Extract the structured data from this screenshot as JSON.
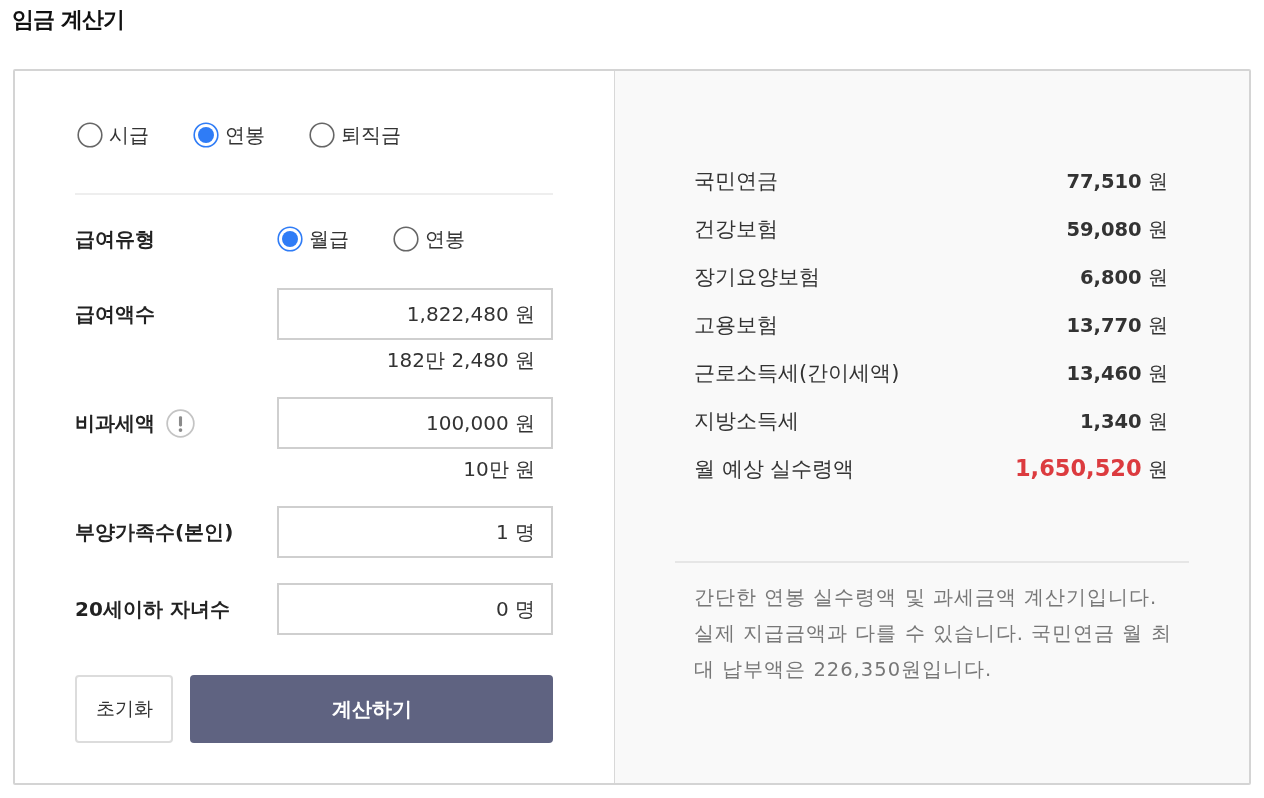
{
  "title": "임금 계산기",
  "calc_type": [
    {
      "label": "시급",
      "selected": false
    },
    {
      "label": "연봉",
      "selected": true
    },
    {
      "label": "퇴직금",
      "selected": false
    }
  ],
  "form": {
    "pay_type": {
      "label": "급여유형",
      "options": [
        {
          "label": "월급",
          "selected": true
        },
        {
          "label": "연봉",
          "selected": false
        }
      ]
    },
    "fields": [
      {
        "label": "급여액수",
        "info": false,
        "value": "1,822,480",
        "unit": "원",
        "hint": "182만 2,480 원"
      },
      {
        "label": "비과세액",
        "info": true,
        "value": "100,000",
        "unit": "원",
        "hint": "10만 원"
      },
      {
        "label": "부양가족수(본인)",
        "info": false,
        "value": "1",
        "unit": "명"
      },
      {
        "label": "20세이하 자녀수",
        "info": false,
        "value": "0",
        "unit": "명"
      }
    ]
  },
  "buttons": [
    {
      "label": "초기화",
      "kind": "secondary"
    },
    {
      "label": "계산하기",
      "kind": "primary"
    }
  ],
  "results": [
    {
      "label": "국민연금",
      "value": "77,510",
      "unit": "원",
      "kind": "deduction"
    },
    {
      "label": "건강보험",
      "value": "59,080",
      "unit": "원",
      "kind": "deduction"
    },
    {
      "label": "장기요양보험",
      "value": "6,800",
      "unit": "원",
      "kind": "deduction"
    },
    {
      "label": "고용보험",
      "value": "13,770",
      "unit": "원",
      "kind": "deduction"
    },
    {
      "label": "근로소득세(간이세액)",
      "value": "13,460",
      "unit": "원",
      "kind": "deduction"
    },
    {
      "label": "지방소득세",
      "value": "1,340",
      "unit": "원",
      "kind": "deduction"
    },
    {
      "label": "월 예상 실수령액",
      "value": "1,650,520",
      "unit": "원",
      "kind": "total"
    }
  ],
  "note": "간단한 연봉 실수령액 및 과세금액 계산기입니다. 실제 지급금액과 다를 수 있습니다. 국민연금 월 최대 납부액은 226,350원입니다."
}
